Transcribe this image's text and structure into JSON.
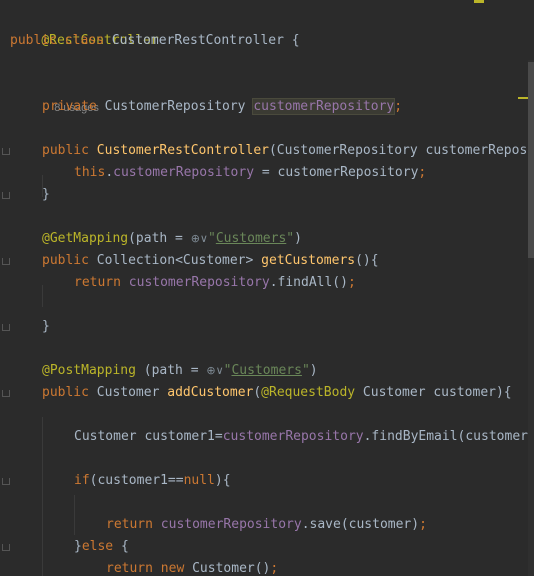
{
  "lines": {
    "l1": {
      "ann": "@RestController"
    },
    "l2": {
      "kw1": "public class ",
      "name": "CustomerRestController",
      "rest": " {"
    },
    "l3": {
      "usages": "8 usages"
    },
    "l4": {
      "kw": "private ",
      "type": "CustomerRepository ",
      "field": "customerRepository",
      "semi": ";"
    },
    "l5": {
      "kw": "public ",
      "fn": "CustomerRestController",
      "rest": "(CustomerRepository customerRepos"
    },
    "l6": {
      "kw": "this",
      "dot": ".",
      "field": "customerRepository",
      "rest": " = customerRepository",
      "semi": ";"
    },
    "l7": {
      "text": "}"
    },
    "l8": {
      "ann": "@GetMapping",
      "pre": "(path = ",
      "globe": "⊕∨",
      "q1": "\"",
      "link": "Customers",
      "q2": "\"",
      "post": ")"
    },
    "l9": {
      "kw": "public ",
      "type": "Collection<Customer> ",
      "fn": "getCustomers",
      "rest": "(){"
    },
    "l10": {
      "kw": "return ",
      "field": "customerRepository",
      "rest": ".findAll()",
      "semi": ";"
    },
    "l11": {
      "text": "}"
    },
    "l12": {
      "ann": "@PostMapping",
      "pre": " (path = ",
      "globe": "⊕∨",
      "q1": "\"",
      "link": "Customers",
      "q2": "\"",
      "post": ")"
    },
    "l13": {
      "kw": "public ",
      "type": "Customer ",
      "fn": "addCustomer",
      "paren": "(",
      "ann": "@RequestBody",
      "rest": " Customer customer){"
    },
    "l14": {
      "pre": "Customer customer1=",
      "field": "customerRepository",
      "rest": ".findByEmail(customer"
    },
    "l15": {
      "kw": "if",
      "pre": "(customer1==",
      "kw2": "null",
      "rest": "){"
    },
    "l16": {
      "kw": "return ",
      "field": "customerRepository",
      "rest": ".save(customer)",
      "semi": ";"
    },
    "l17": {
      "pre": "}",
      "kw": "else",
      "rest": " {"
    },
    "l18": {
      "kw": "return ",
      "kw2": "new ",
      "rest": "Customer()",
      "semi": ";"
    }
  }
}
